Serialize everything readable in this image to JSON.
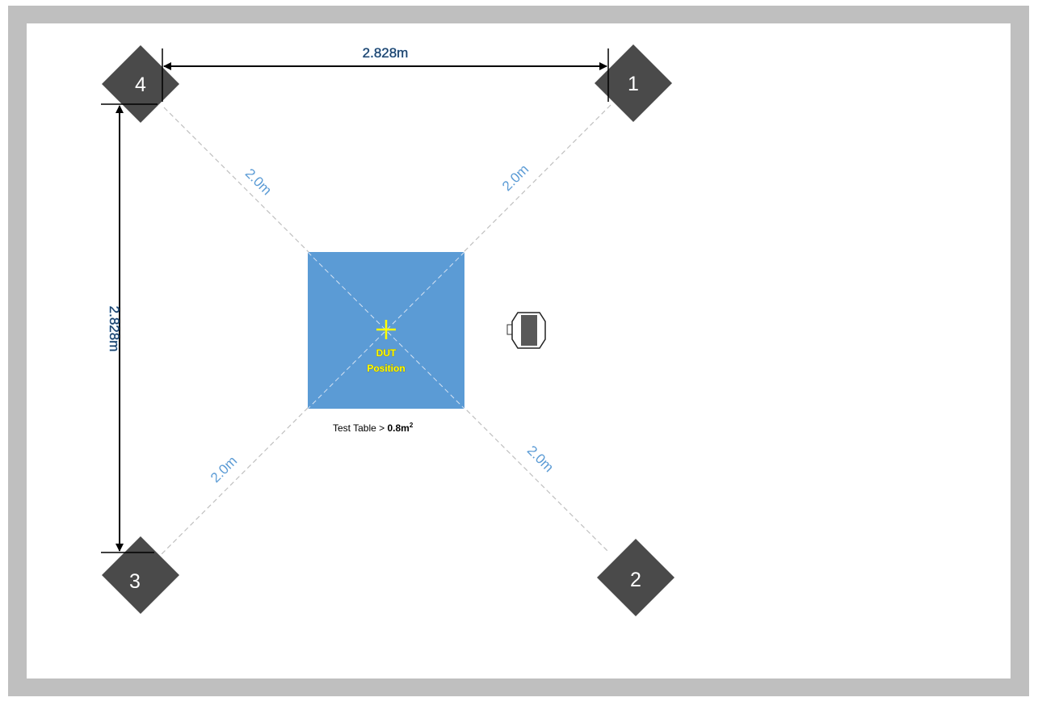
{
  "diagram": {
    "speakers": [
      {
        "id": "1",
        "label": "1"
      },
      {
        "id": "2",
        "label": "2"
      },
      {
        "id": "3",
        "label": "3"
      },
      {
        "id": "4",
        "label": "4"
      }
    ],
    "distances": {
      "speaker_1": "2.0m",
      "speaker_2": "2.0m",
      "speaker_3": "2.0m",
      "speaker_4": "2.0m"
    },
    "dimensions": {
      "horizontal": "2.828m",
      "vertical": "2.828m"
    },
    "dut": {
      "line1": "DUT",
      "line2": "Position"
    },
    "table": {
      "label_prefix": "Test Table > ",
      "label_value": "0.8m",
      "label_exponent": "2"
    },
    "colors": {
      "frame": "#bfbfbf",
      "speaker": "#4a4a4a",
      "table": "#5b9bd5",
      "dashed_line": "#bfbfbf",
      "dut_marker": "#ffff00",
      "distance_text": "#5b9bd5"
    },
    "icons": [
      "speaker-icon",
      "cross-marker-icon",
      "microphone-icon",
      "arrow-icon"
    ]
  }
}
